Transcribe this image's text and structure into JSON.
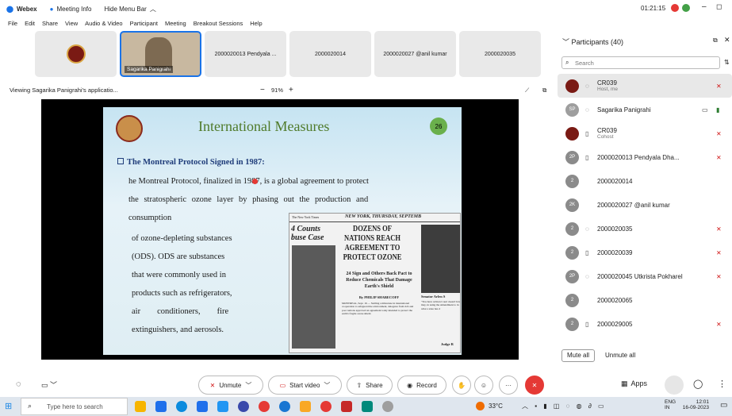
{
  "titlebar": {
    "app": "Webex",
    "meeting_info": "Meeting Info",
    "hide_menu": "Hide Menu Bar",
    "timer": "01:21:15",
    "min": "–",
    "max": "◻"
  },
  "menu": [
    "File",
    "Edit",
    "Share",
    "View",
    "Audio & Video",
    "Participant",
    "Meeting",
    "Breakout Sessions",
    "Help"
  ],
  "thumbs": [
    {
      "label": ""
    },
    {
      "label": "Sagarika Panigrahi"
    },
    {
      "label": "2000020013 Pendyala ..."
    },
    {
      "label": "2000020014"
    },
    {
      "label": "2000020027 @anil kumar"
    },
    {
      "label": "2000020035"
    }
  ],
  "viewbar": {
    "viewing": "Viewing Sagarika Panigrahi's applicatio...",
    "zoom": "91%",
    "minus": "−",
    "plus": "+"
  },
  "slide": {
    "title": "International Measures",
    "number": "26",
    "subheading": "The Montreal Protocol Signed in 1987:",
    "line1": "he Montreal Protocol, finalized in 1987, is a global agreement to protect",
    "line2": "the stratospheric ozone layer by phasing out the production and",
    "line3": "consumption",
    "left_para": [
      "of ozone-depleting substances",
      "(ODS). ODS are substances",
      "that were commonly used in",
      "products such as refrigerators,",
      "air        conditioners,        fire",
      "extinguishers, and aerosols."
    ],
    "paper": {
      "masthead_left": "The New York Times",
      "masthead_right": "NEW YORK, THURSDAY, SEPTEMB",
      "left_head": "4 Counts buse Case",
      "headline": "DOZENS OF NATIONS REACH AGREEMENT TO PROTECT OZONE",
      "subhead": "24 Sign and Others Back Pact to Reduce Chemicals That Damage Earth's Shield",
      "byline": "By PHILIP SHABECOFF",
      "dateline": "MONTREAL, Sept. 16 — Stalling a milestone in international cooperation to safeguard the environment, delegates from rich and poor nations approved an agreement today intended to protect the earth's fragile ozone shield.",
      "right_head": "Senator Arlen S",
      "right_body": "\"You have written Court doesn't hav may, in using the Amendment to in what a state has d",
      "right_foot": "Judge R"
    }
  },
  "panel": {
    "title": "Participants (40)",
    "search_placeholder": "Search",
    "participants": [
      {
        "avatar": "",
        "name": "CR039",
        "role": "Host, me"
      },
      {
        "avatar": "SP",
        "name": "Sagarika Panigrahi",
        "role": ""
      },
      {
        "avatar": "",
        "name": "CR039",
        "role": "Cohost"
      },
      {
        "avatar": "2P",
        "name": "2000020013 Pendyala  Dha...",
        "role": ""
      },
      {
        "avatar": "2",
        "name": "2000020014",
        "role": ""
      },
      {
        "avatar": "2K",
        "name": "2000020027 @anil kumar",
        "role": ""
      },
      {
        "avatar": "2",
        "name": "2000020035",
        "role": ""
      },
      {
        "avatar": "2",
        "name": "2000020039",
        "role": ""
      },
      {
        "avatar": "2P",
        "name": "2000020045 Utkrista Pokharel",
        "role": ""
      },
      {
        "avatar": "2",
        "name": "2000020065",
        "role": ""
      },
      {
        "avatar": "2",
        "name": "2000029005",
        "role": ""
      }
    ],
    "mute_all": "Mute all",
    "unmute_all": "Unmute all"
  },
  "controls": {
    "unmute": "Unmute",
    "start_video": "Start video",
    "share": "Share",
    "record": "Record",
    "apps": "Apps"
  },
  "taskbar": {
    "search_placeholder": "Type here to search",
    "weather": "33°C",
    "lang": "ENG",
    "region": "IN",
    "time": "12:01",
    "date": "16-09-2023"
  }
}
